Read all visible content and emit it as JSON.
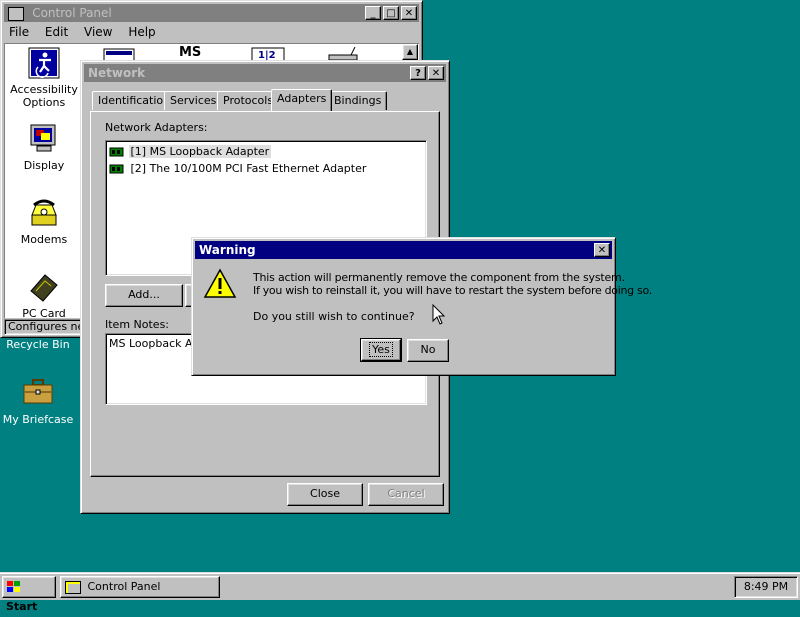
{
  "desktop": {
    "recycle_bin": "Recycle Bin",
    "my_briefcase": "My Briefcase"
  },
  "control_panel": {
    "title": "Control Panel",
    "menu": [
      "File",
      "Edit",
      "View",
      "Help"
    ],
    "items": [
      {
        "label": "Accessibility Options",
        "icon": "accessibility-icon"
      },
      {
        "label": "Display",
        "icon": "display-icon"
      },
      {
        "label": "Modems",
        "icon": "modems-icon"
      },
      {
        "label": "PC Card",
        "icon": "pc-card-icon"
      }
    ],
    "top_icons": [
      "add-hardware-icon",
      "msdos-icon",
      "add-remove-icon",
      "network-cable-icon"
    ],
    "status": "Configures netw"
  },
  "network": {
    "title": "Network",
    "tabs": [
      "Identification",
      "Services",
      "Protocols",
      "Adapters",
      "Bindings"
    ],
    "active_tab": "Adapters",
    "adapters_label": "Network Adapters:",
    "adapters": [
      "[1] MS Loopback Adapter",
      "[2] The 10/100M PCI Fast Ethernet Adapter"
    ],
    "add_button": "Add...",
    "item_notes_label": "Item Notes:",
    "item_notes": "MS Loopback Ad",
    "close_button": "Close",
    "cancel_button": "Cancel"
  },
  "warning": {
    "title": "Warning",
    "line1": "This action will permanently remove the component from the system.",
    "line2": "If you wish to reinstall it, you will have to restart the system before doing so.",
    "question": "Do you still wish to continue?",
    "yes_button": "Yes",
    "no_button": "No"
  },
  "taskbar": {
    "start": "Start",
    "task": "Control Panel",
    "clock": "8:49 PM"
  },
  "colors": {
    "desktop": "#008080",
    "title_active": "#000080",
    "title_inactive": "#808080",
    "face": "#c0c0c0"
  }
}
